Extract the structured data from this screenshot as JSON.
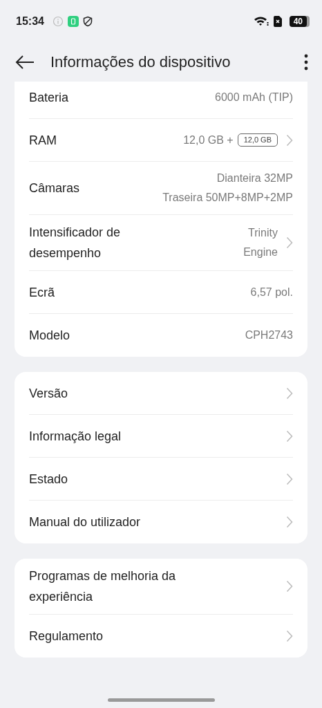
{
  "status_bar": {
    "time": "15:34",
    "battery": "40"
  },
  "header": {
    "title": "Informações do dispositivo"
  },
  "cards": [
    {
      "rows": [
        {
          "label": "Bateria",
          "values": [
            "6000 mAh (TIP)"
          ],
          "arrow": false
        },
        {
          "label": "RAM",
          "values": [
            "12,0 GB +"
          ],
          "badge": "12,0 GB",
          "arrow": true
        },
        {
          "label": "Câmaras",
          "values": [
            "Dianteira 32MP",
            "Traseira 50MP+8MP+2MP"
          ],
          "arrow": false
        },
        {
          "label": "Intensificador de desempenho",
          "values": [
            "Trinity",
            "Engine"
          ],
          "arrow": true
        },
        {
          "label": "Ecrã",
          "values": [
            "6,57 pol."
          ],
          "arrow": false
        },
        {
          "label": "Modelo",
          "values": [
            "CPH2743"
          ],
          "arrow": false
        }
      ]
    },
    {
      "rows": [
        {
          "label": "Versão",
          "arrow": true
        },
        {
          "label": "Informação legal",
          "arrow": true
        },
        {
          "label": "Estado",
          "arrow": true
        },
        {
          "label": "Manual do utilizador",
          "arrow": true
        }
      ]
    },
    {
      "rows": [
        {
          "label": "Programas de melhoria da experiência",
          "arrow": true
        },
        {
          "label": "Regulamento",
          "arrow": true
        }
      ]
    }
  ]
}
